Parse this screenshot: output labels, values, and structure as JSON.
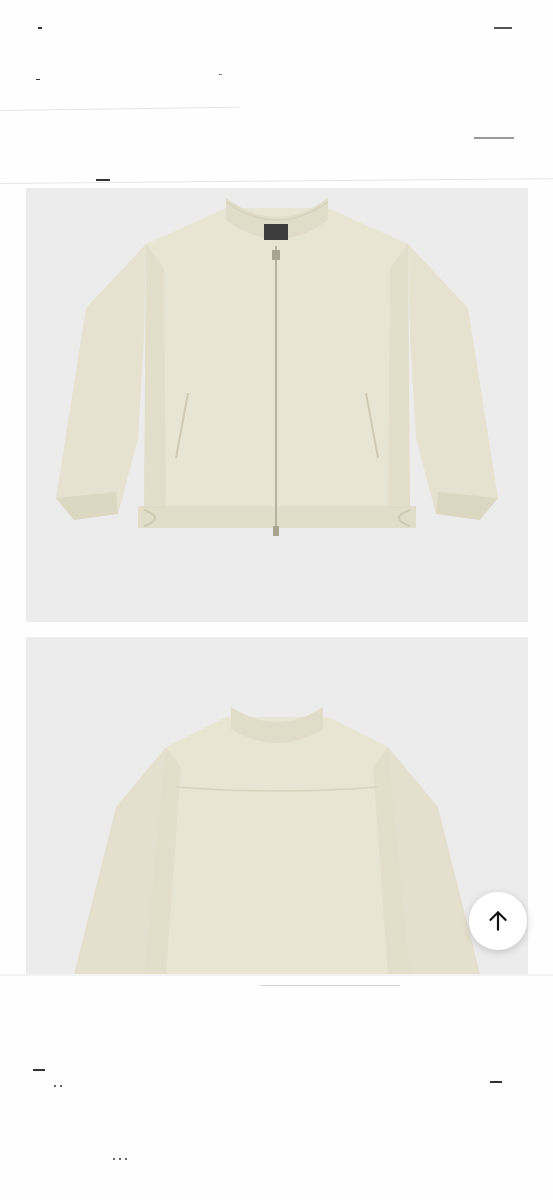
{
  "product_images": {
    "front": {
      "alt": ""
    },
    "back": {
      "alt": ""
    }
  },
  "scroll_top": {
    "icon": "arrow-up-icon"
  },
  "colors": {
    "jacket": "#e8e4d2",
    "jacket_shadow": "#d8d3bd",
    "photo_background": "#ececec",
    "zipper": "#b8b39f"
  }
}
